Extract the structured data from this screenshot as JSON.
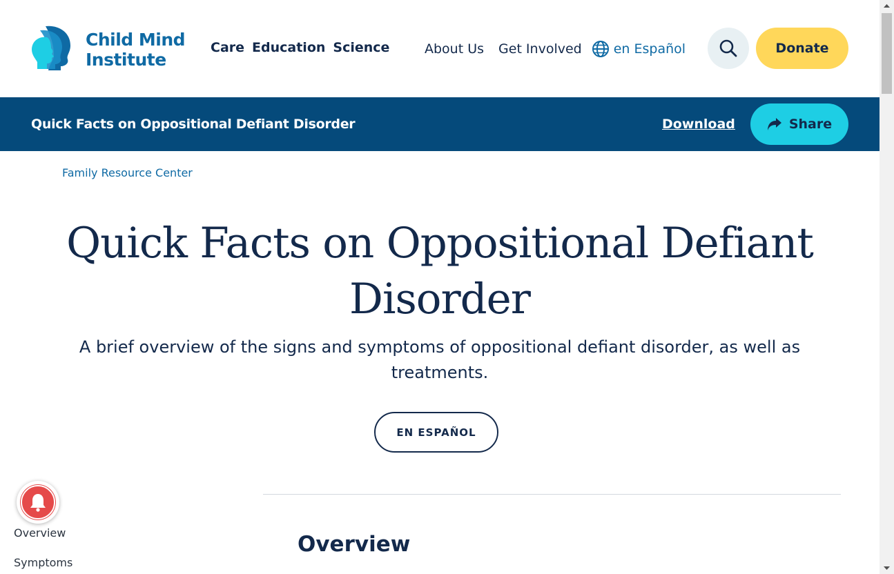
{
  "header": {
    "logo": {
      "line1": "Child Mind",
      "line2": "Institute"
    },
    "primary_nav": [
      "Care",
      "Education",
      "Science"
    ],
    "secondary_nav": {
      "about": "About Us",
      "get_involved": "Get Involved",
      "language": "en Español"
    },
    "donate_label": "Donate"
  },
  "article_bar": {
    "title": "Quick Facts on Oppositional Defiant Disorder",
    "download_label": "Download",
    "share_label": "Share"
  },
  "breadcrumb": "Family Resource Center",
  "page": {
    "title": "Quick Facts on Oppositional Defiant Disorder",
    "subtitle": "A brief overview of the signs and symptoms of oppositional defiant disorder, as well as treatments.",
    "espanol_button": "EN ESPAÑOL",
    "section_heading": "Overview"
  },
  "toc": {
    "items": [
      "Overview",
      "Symptoms"
    ]
  },
  "colors": {
    "navy": "#13294b",
    "brand_blue": "#0f6aa4",
    "bar_blue": "#054a7b",
    "donate_yellow": "#ffd75a",
    "share_cyan": "#1ecee4",
    "notification_red": "#e54a4a"
  }
}
